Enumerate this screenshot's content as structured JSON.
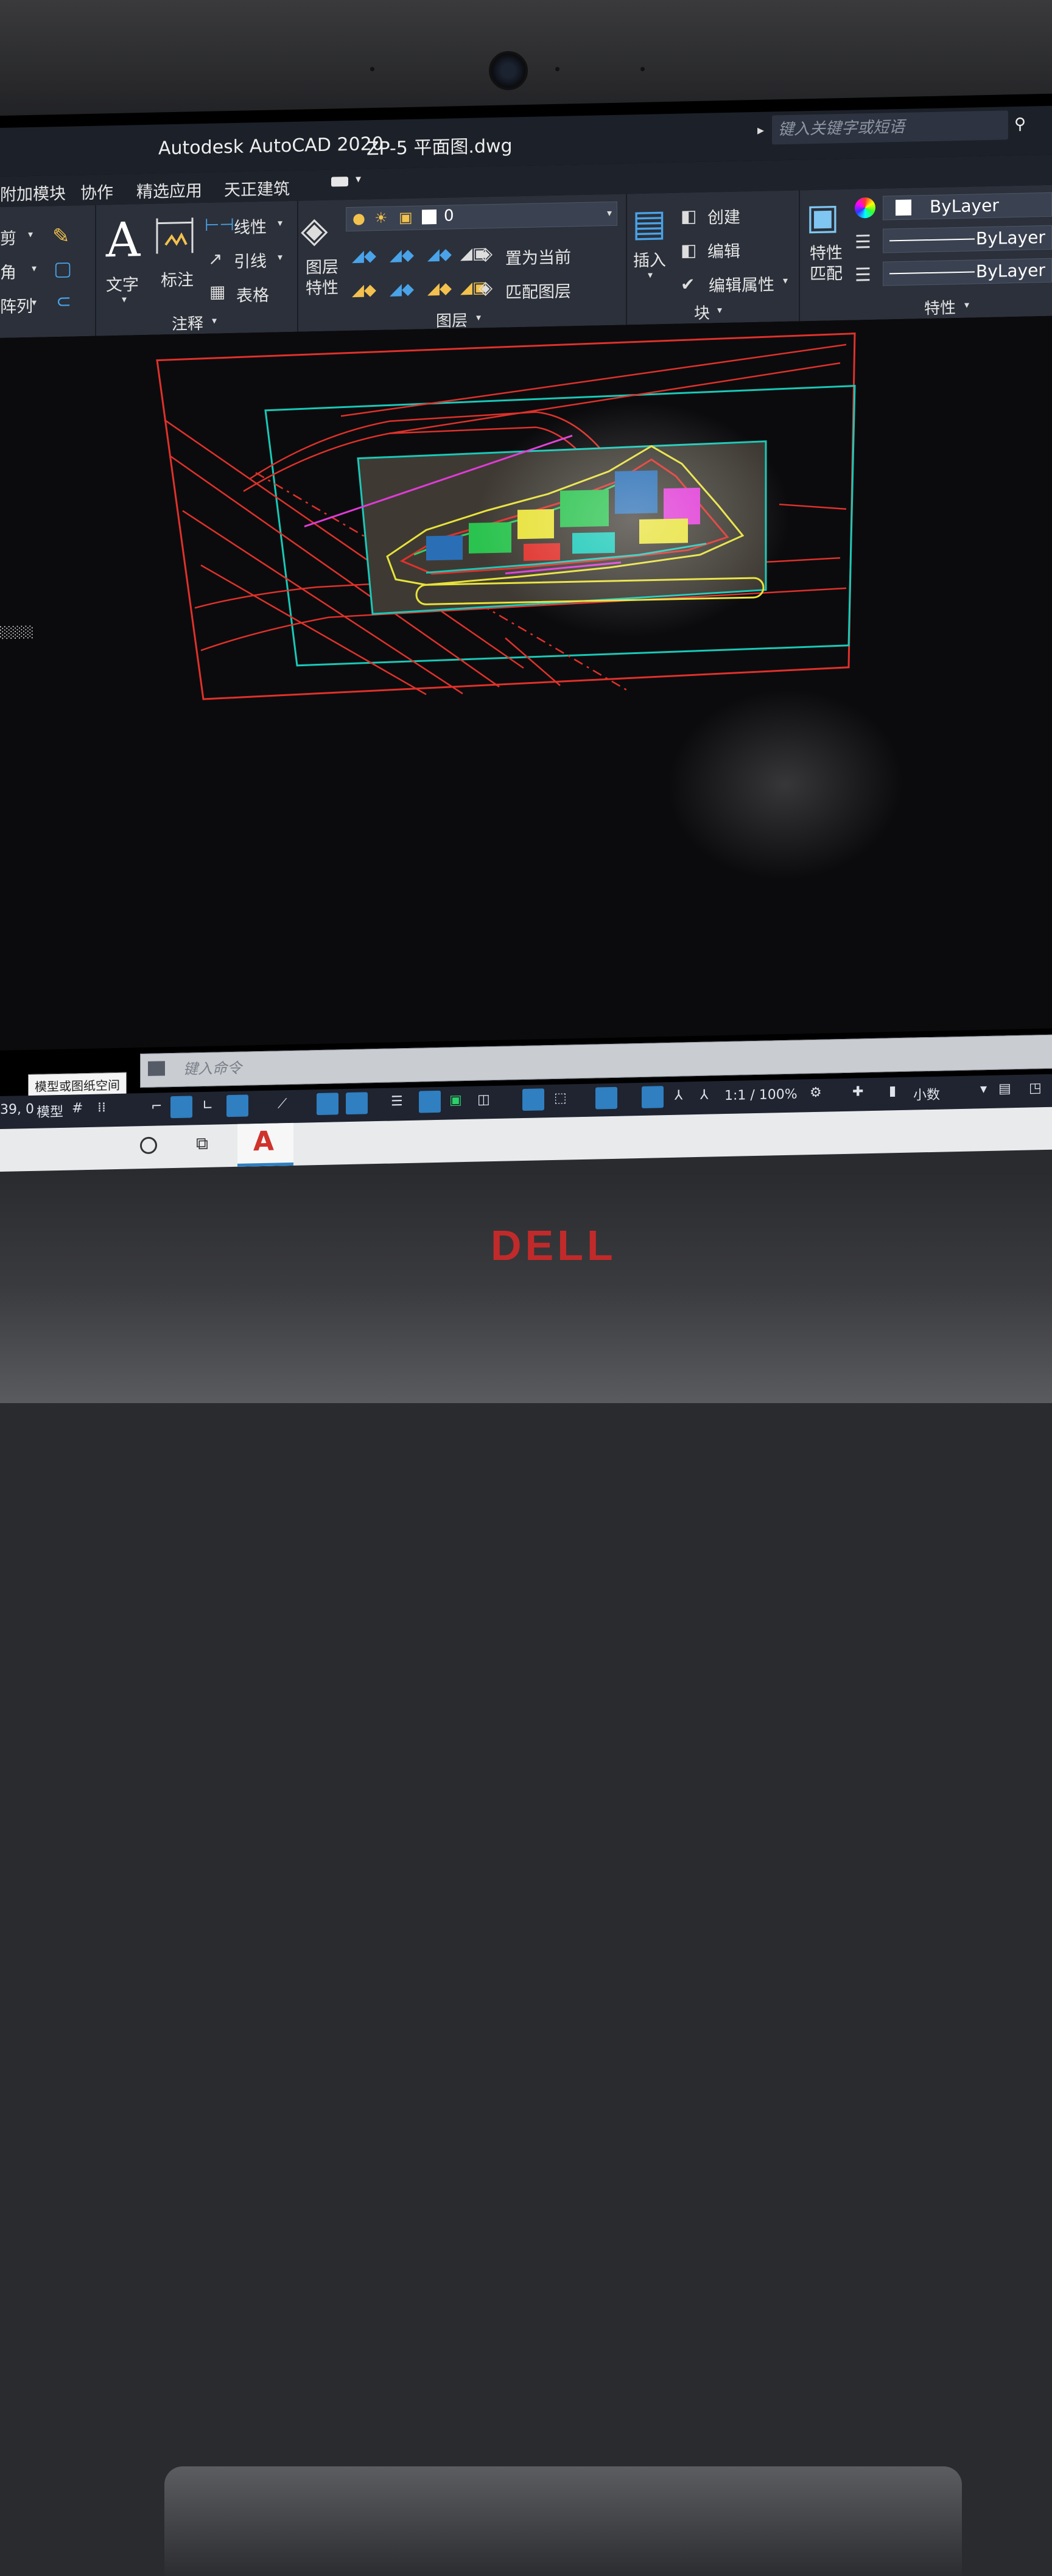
{
  "window": {
    "app_title": "Autodesk AutoCAD 2020",
    "doc_title": "ZP-5 平面图.dwg",
    "search_placeholder": "键入关键字或短语"
  },
  "menu": {
    "tabs": [
      "附加模块",
      "协作",
      "精选应用",
      "天正建筑"
    ]
  },
  "ribbon": {
    "modify_partial": [
      "剪",
      "角",
      "阵列"
    ],
    "annotation": {
      "text_label": "文字",
      "dim_label": "标注",
      "linear_label": "线性",
      "leader_label": "引线",
      "table_label": "表格",
      "title": "注释"
    },
    "layers": {
      "properties_label": "图层特性",
      "current_layer": "0",
      "set_current": "置为当前",
      "match_layer": "匹配图层",
      "title": "图层"
    },
    "block": {
      "insert_label": "插入",
      "create_label": "创建",
      "edit_label": "编辑",
      "edit_attr_label": "编辑属性",
      "title": "块"
    },
    "properties": {
      "match_label": "特性匹配",
      "color": "ByLayer",
      "linetype": "ByLayer",
      "lineweight": "ByLayer",
      "title": "特性"
    }
  },
  "command": {
    "placeholder": "键入命令"
  },
  "tooltip": "模型或图纸空间",
  "status": {
    "coords": "39, 0",
    "model": "模型",
    "scale": "1:1 / 100%",
    "units": "小数"
  },
  "hardware": {
    "brand": "DELL"
  },
  "colors": {
    "ribbon_bg": "#2b303a",
    "title_bg": "#1c2028",
    "drawing_bg": "#0b0b0d",
    "cad_red": "#e0312b",
    "cad_cyan": "#19c9b8",
    "cad_yellow": "#e8e23a",
    "accent_blue": "#2f7fc1"
  }
}
